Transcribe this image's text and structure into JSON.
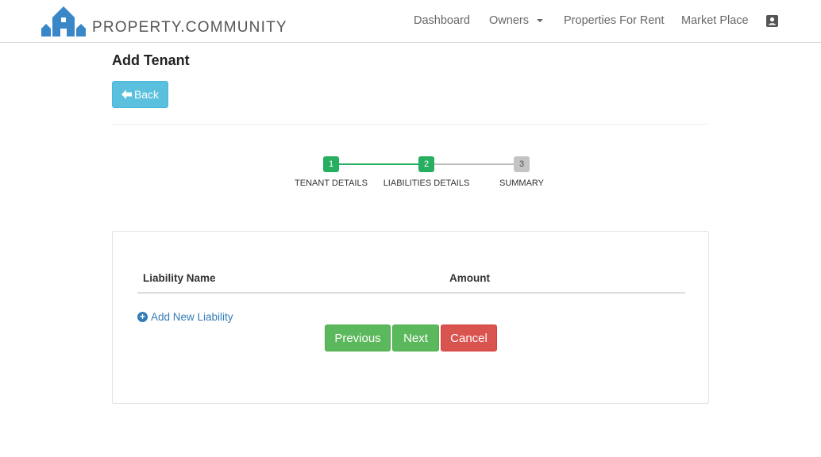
{
  "brand": {
    "name": "PROPERTY.COMMUNITY",
    "color": "#3a87c8"
  },
  "nav": {
    "dashboard": "Dashboard",
    "owners": "Owners",
    "properties_for_rent": "Properties For Rent",
    "market_place": "Market Place",
    "user_icon": "account-box-icon"
  },
  "page": {
    "title": "Add Tenant",
    "back_label": "Back"
  },
  "steps": [
    {
      "number": "1",
      "label": "TENANT DETAILS",
      "state": "complete"
    },
    {
      "number": "2",
      "label": "LIABILITIES DETAILS",
      "state": "active"
    },
    {
      "number": "3",
      "label": "SUMMARY",
      "state": "pending"
    }
  ],
  "colors": {
    "step_done": "#27ae60",
    "step_pending": "#bdbdbd",
    "info": "#5bc0de",
    "success": "#5cb85c",
    "danger": "#d9534f",
    "link": "#337ab7"
  },
  "table": {
    "columns": [
      "Liability Name",
      "Amount"
    ],
    "rows": []
  },
  "actions": {
    "add_new": "Add New Liability",
    "previous": "Previous",
    "next": "Next",
    "cancel": "Cancel"
  }
}
